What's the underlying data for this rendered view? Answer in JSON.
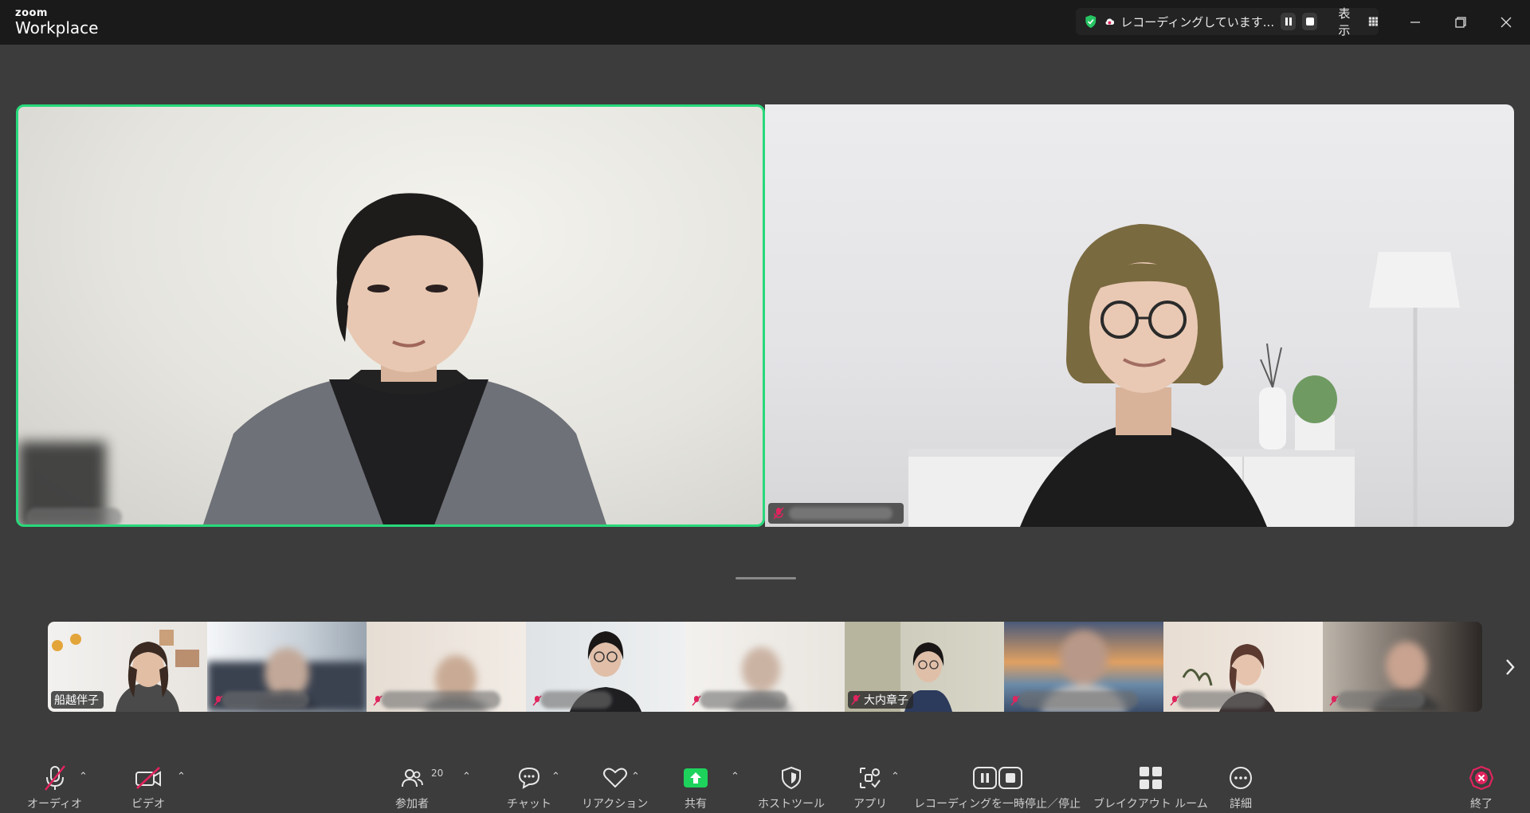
{
  "titlebar": {
    "brand_small": "zoom",
    "brand_large": "Workplace",
    "recording_status": "レコーディングしています...",
    "view_label": "表示"
  },
  "main": {
    "speaker_tile": {
      "active_border_color": "#27d97a"
    },
    "second_tile": {}
  },
  "gallery": {
    "thumbs": [
      {
        "name": "船越伴子",
        "muted": false
      },
      {
        "name": "",
        "muted": true
      },
      {
        "name": "",
        "muted": true
      },
      {
        "name": "",
        "muted": true
      },
      {
        "name": "",
        "muted": true
      },
      {
        "name": "大内章子",
        "muted": true
      },
      {
        "name": "",
        "muted": true
      },
      {
        "name": "",
        "muted": true
      },
      {
        "name": "",
        "muted": true
      }
    ]
  },
  "toolbar": {
    "audio_label": "オーディオ",
    "video_label": "ビデオ",
    "participants_label": "参加者",
    "participants_count": "20",
    "chat_label": "チャット",
    "reactions_label": "リアクション",
    "share_label": "共有",
    "host_tools_label": "ホストツール",
    "apps_label": "アプリ",
    "recording_label": "レコーディングを一時停止／停止",
    "breakout_label": "ブレイクアウト ルーム",
    "more_label": "詳細",
    "end_label": "終了"
  },
  "colors": {
    "active_speaker": "#27d97a",
    "share_green": "#1dd35c",
    "end_red": "#e0245e",
    "muted_red": "#e0245e"
  },
  "icons": [
    "shield-check-icon",
    "cloud-record-icon",
    "pause-icon",
    "stop-icon",
    "grid-icon",
    "minimize-icon",
    "restore-icon",
    "close-icon",
    "mic-muted-icon",
    "video-off-icon",
    "participants-icon",
    "chat-icon",
    "heart-icon",
    "share-arrow-icon",
    "host-shield-icon",
    "apps-icon",
    "record-pause-stop-icon",
    "breakout-grid-icon",
    "more-icon",
    "end-icon",
    "chevron-right-icon"
  ]
}
